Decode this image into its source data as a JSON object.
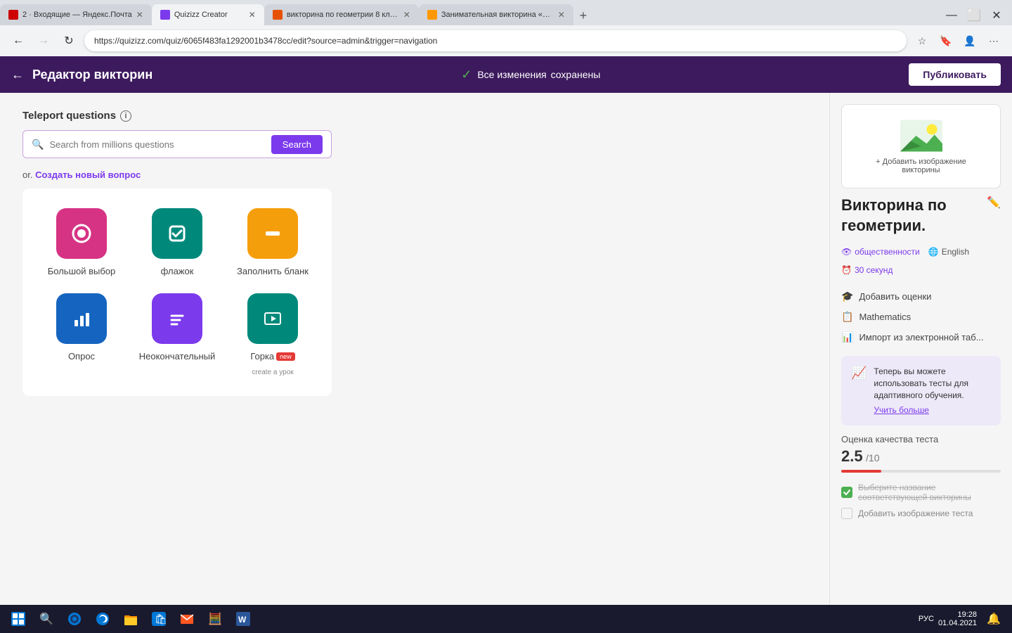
{
  "browser": {
    "tabs": [
      {
        "id": "tab1",
        "favicon_color": "#cc0000",
        "title": "2 · Входящие — Яндекс.Почта",
        "active": false
      },
      {
        "id": "tab2",
        "favicon_color": "#7c3aed",
        "title": "Quizizz Creator",
        "active": true
      },
      {
        "id": "tab3",
        "favicon_color": "#e65100",
        "title": "викторина по геометрии 8 кла...",
        "active": false
      },
      {
        "id": "tab4",
        "favicon_color": "#ff9800",
        "title": "Занимательная викторина «Ве...",
        "active": false
      }
    ],
    "address": "https://quizizz.com/quiz/6065f483fa1292001b3478cc/edit?source=admin&trigger=navigation"
  },
  "header": {
    "back_label": "←",
    "title": "Редактор викторин",
    "saved_line1": "Все изменения",
    "saved_line2": "сохранены",
    "publish_label": "Публиковать"
  },
  "teleport": {
    "title": "Teleport questions",
    "search_placeholder": "Search from millions questions",
    "search_button": "Search"
  },
  "create": {
    "or_text": "or.",
    "link_text": "Создать новый вопрос"
  },
  "question_types": [
    {
      "id": "mcq",
      "label": "Большой выбор",
      "color": "#d63384",
      "icon": "⊙"
    },
    {
      "id": "checkbox",
      "label": "флажок",
      "color": "#00897b",
      "icon": "✓"
    },
    {
      "id": "fill",
      "label": "Заполнить бланк",
      "color": "#f59e0b",
      "icon": "▬"
    },
    {
      "id": "poll",
      "label": "Опрос",
      "color": "#1565c0",
      "icon": "▦"
    },
    {
      "id": "open",
      "label": "Неокончательный",
      "color": "#7c3aed",
      "icon": "≡"
    },
    {
      "id": "slide",
      "label": "Горка",
      "color": "#00897b",
      "icon": "▭",
      "badge": "new",
      "sublabel": "create a урок"
    }
  ],
  "sidebar": {
    "add_image_text": "+ Добавить изображение\nвикторины",
    "quiz_name": "Викторина по геометрии.",
    "meta": [
      {
        "id": "visibility",
        "icon": "👁",
        "label": "общественности",
        "color": "#7c3aed"
      },
      {
        "id": "language",
        "icon": "⬛",
        "label": "English",
        "color": "#555"
      },
      {
        "id": "time",
        "icon": "⏰",
        "label": "30 секунд",
        "color": "#7c3aed"
      }
    ],
    "actions": [
      {
        "id": "grades",
        "icon": "🎓",
        "label": "Добавить оценки"
      },
      {
        "id": "subject",
        "icon": "📋",
        "label": "Mathematics"
      },
      {
        "id": "import",
        "icon": "📊",
        "label": "Импорт из электронной таб..."
      }
    ],
    "adaptive_text": "Теперь вы можете использовать тесты для адаптивного обучения.",
    "adaptive_link": "Учить больше",
    "quality_label": "Оценка качества теста",
    "quality_score": "2.5",
    "quality_denom": "/10",
    "quality_pct": 25,
    "checklist": [
      {
        "id": "name",
        "checked": true,
        "text": "Выберите название соответствующей викторины"
      },
      {
        "id": "image",
        "checked": false,
        "text": "Добавить изображение теста"
      }
    ]
  },
  "taskbar": {
    "time": "19:28",
    "date": "01.04.2021",
    "lang": "РУС"
  }
}
